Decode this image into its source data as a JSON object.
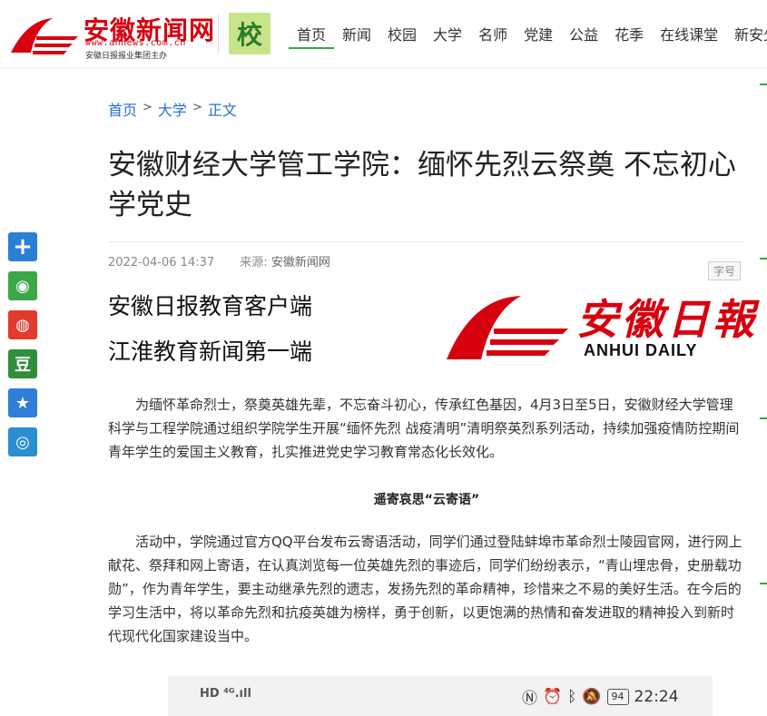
{
  "site": {
    "name": "安徽新闻网",
    "url": "www.ahnews.com.cn",
    "sponsor": "安徽日报报业集团主办",
    "campus_badge": "校"
  },
  "nav": {
    "items": [
      "首页",
      "新闻",
      "校园",
      "大学",
      "名师",
      "党建",
      "公益",
      "花季",
      "在线课堂",
      "新安少"
    ],
    "active": "首页"
  },
  "breadcrumb": [
    "首页",
    "大学",
    "正文"
  ],
  "article": {
    "title": "安徽财经大学管工学院：缅怀先烈云祭奠 不忘初心学党史",
    "date": "2022-04-06 14:37",
    "source_label": "来源:",
    "source": "安徽新闻网",
    "font_size_label": "字号",
    "banner_line1": "安徽日报教育客户端",
    "banner_line2": "江淮教育新闻第一端",
    "banner_cn": "安徽日報",
    "banner_en": "ANHUI DAILY",
    "para1": "为缅怀革命烈士，祭奠英雄先辈，不忘奋斗初心，传承红色基因，4月3日至5日，安徽财经大学管理科学与工程学院通过组织学院学生开展“缅怀先烈 战疫清明”清明祭英烈系列活动，持续加强疫情防控期间青年学生的爱国主义教育，扎实推进党史学习教育常态化长效化。",
    "subheading": "遥寄哀思“云寄语”",
    "para2": "活动中，学院通过官方QQ平台发布云寄语活动，同学们通过登陆蚌埠市革命烈士陵园官网，进行网上献花、祭拜和网上寄语，在认真浏览每一位英雄先烈的事迹后，同学们纷纷表示，“青山埋忠骨，史册载功勋”，作为青年学生，要主动继承先烈的遗志，发扬先烈的革命精神，珍惜来之不易的美好生活。在今后的学习生活中，将以革命先烈和抗疫英雄为榜样，勇于创新，以更饱满的热情和奋发进取的精神投入到新时代现代化国家建设当中。"
  },
  "phone_status": {
    "left": "HD ⁴ᴳ.ıll",
    "battery": "94",
    "time": "22:24"
  },
  "share_icons": [
    {
      "name": "share-plus-icon",
      "glyph": "+",
      "color": "#2a7fd4"
    },
    {
      "name": "wechat-icon",
      "glyph": "◉",
      "color": "#3aa846"
    },
    {
      "name": "weibo-icon",
      "glyph": "◍",
      "color": "#e33a2b"
    },
    {
      "name": "douban-icon",
      "glyph": "豆",
      "color": "#2f8f3a"
    },
    {
      "name": "qzone-icon",
      "glyph": "★",
      "color": "#2f7ed8"
    },
    {
      "name": "tencent-weibo-icon",
      "glyph": "◎",
      "color": "#2a8fd1"
    }
  ],
  "colors": {
    "brand_red": "#d7000f",
    "link_blue": "#2a6fc9",
    "nav_accent": "#2ea84b"
  }
}
